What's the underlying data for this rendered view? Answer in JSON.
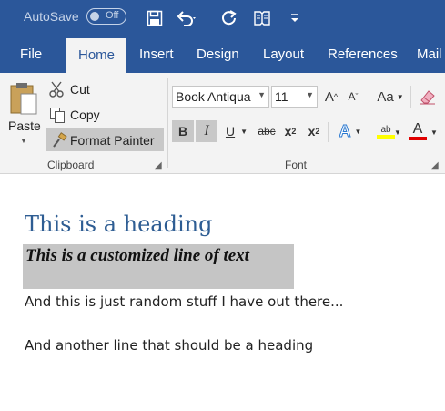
{
  "qat": {
    "autosave_label": "AutoSave",
    "autosave_state": "Off",
    "save_icon": "save-icon",
    "undo_icon": "undo-icon",
    "redo_icon": "repeat-icon",
    "touch_icon": "touch-mode-icon",
    "customize_icon": "customize-qat-icon"
  },
  "tabs": [
    "File",
    "Home",
    "Insert",
    "Design",
    "Layout",
    "References",
    "Mail"
  ],
  "active_tab": "Home",
  "clipboard": {
    "paste_label": "Paste",
    "cut_label": "Cut",
    "copy_label": "Copy",
    "format_painter_label": "Format Painter",
    "group_label": "Clipboard"
  },
  "font": {
    "family": "Book Antiqua",
    "size": "11",
    "grow_label": "A",
    "shrink_label": "A",
    "case_label": "Aa",
    "bold_label": "B",
    "italic_label": "I",
    "underline_label": "U",
    "strike_label": "abc",
    "subscript_label": "x",
    "subscript_sub": "2",
    "superscript_label": "x",
    "superscript_sup": "2",
    "effects_label": "A",
    "highlight_label": "ab",
    "color_label": "A",
    "group_label": "Font",
    "highlight_color": "#ffff00",
    "font_color": "#e00000"
  },
  "document": {
    "heading": "This is a heading",
    "custom_line": "This is a customized line of text",
    "para1": "And this is just random stuff I have out there...",
    "para2": "And another line that should be a heading"
  },
  "colors": {
    "title_bar": "#2b579a",
    "ribbon": "#f3f3f3",
    "heading": "#2e5d93",
    "custom_bg": "#c5c5c5"
  }
}
